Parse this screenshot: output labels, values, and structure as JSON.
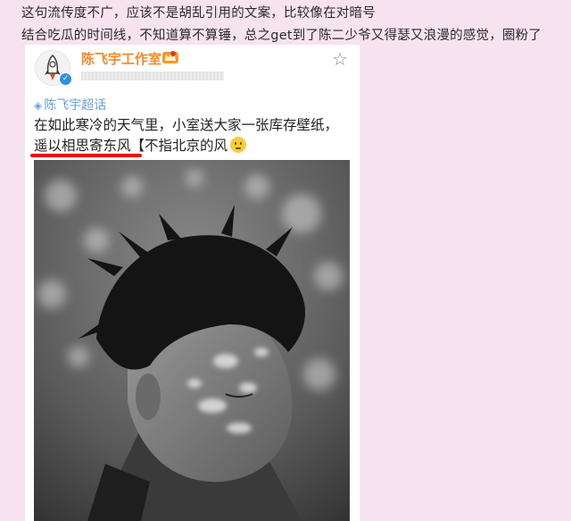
{
  "captions": {
    "line1": "这句流传度不广，应该不是胡乱引用的文案，比较像在对暗号",
    "line2": "结合吃瓜的时间线，不知道算不算锤，总之get到了陈二少爷又得瑟又浪漫的感觉，圈粉了"
  },
  "post": {
    "account_name": "陈飞宇工作室",
    "topic_label": "陈飞宇超话",
    "text_line1": "在如此寒冷的天气里，小室送大家一张库存壁纸，",
    "text_line2_highlight": "遥以相思寄东风",
    "text_line2_rest": "【不指北京的风",
    "icons": {
      "avatar": "rocket-avatar",
      "verified": "verified-badge-icon",
      "badge": "crown-badge-icon",
      "star": "star-icon",
      "topic": "supertopic-icon",
      "emoji": "smile-emoji-icon"
    },
    "colors": {
      "account_name": "#f08a2a",
      "topic": "#6b9fd6",
      "underline": "#e3101a",
      "background": "#f7e3ef"
    }
  }
}
